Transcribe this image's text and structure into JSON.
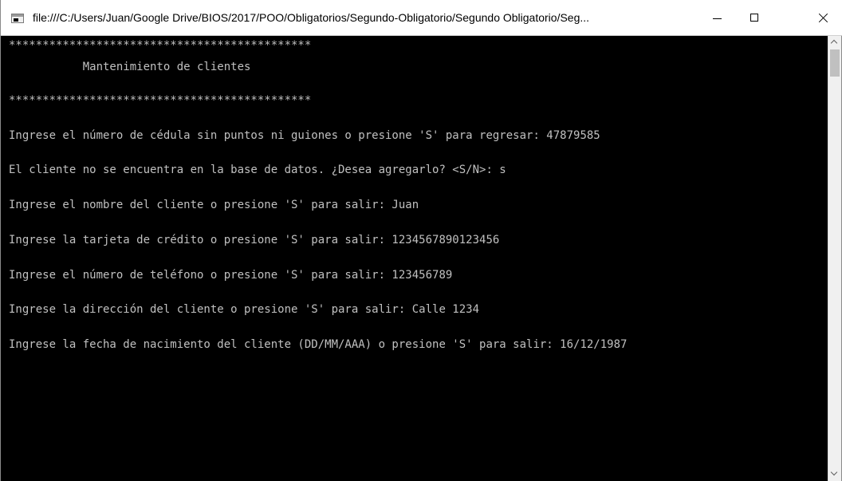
{
  "window": {
    "title": "file:///C:/Users/Juan/Google Drive/BIOS/2017/POO/Obligatorios/Segundo-Obligatorio/Segundo Obligatorio/Seg...",
    "icon": "console-app-icon"
  },
  "controls": {
    "minimize_icon": "minimize-icon",
    "maximize_icon": "maximize-icon",
    "close_icon": "close-icon"
  },
  "console": {
    "lines": [
      "*********************************************",
      "           Mantenimiento de clientes",
      "*********************************************",
      "Ingrese el número de cédula sin puntos ni guiones o presione 'S' para regresar: 47879585",
      "El cliente no se encuentra en la base de datos. ¿Desea agregarlo? <S/N>: s",
      "Ingrese el nombre del cliente o presione 'S' para salir: Juan",
      "Ingrese la tarjeta de crédito o presione 'S' para salir: 1234567890123456",
      "Ingrese el número de teléfono o presione 'S' para salir: 123456789",
      "Ingrese la dirección del cliente o presione 'S' para salir: Calle 1234",
      "Ingrese la fecha de nacimiento del cliente (DD/MM/AAA) o presione 'S' para salir: 16/12/1987"
    ]
  },
  "colors": {
    "console_background": "#000000",
    "console_text": "#c0c0c0",
    "titlebar": "#ffffff"
  }
}
